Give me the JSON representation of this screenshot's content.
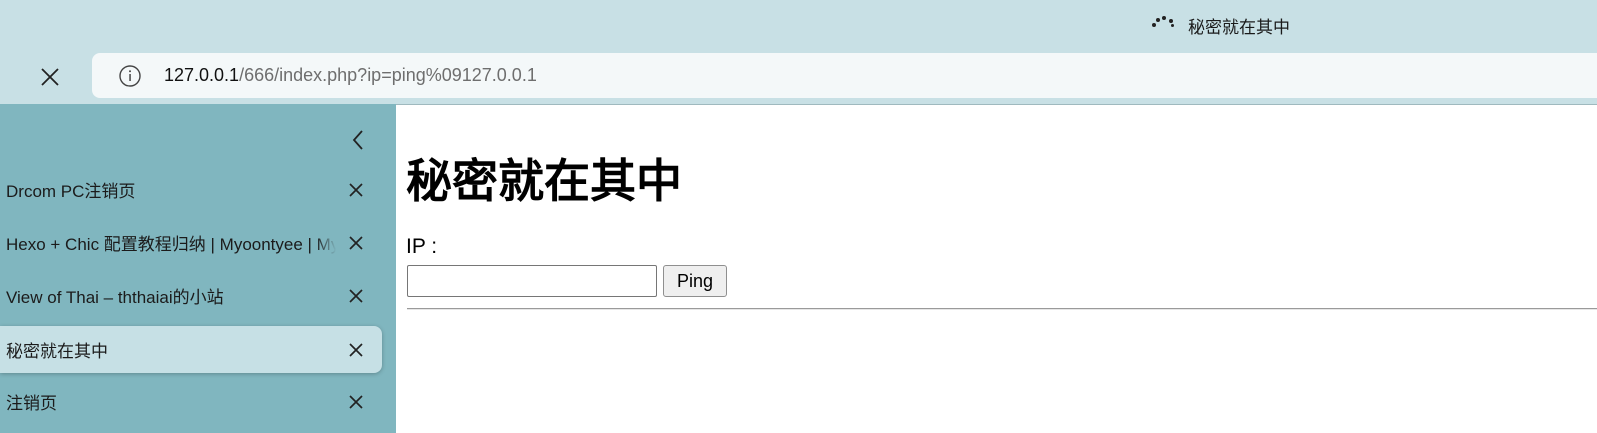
{
  "window": {
    "title": "秘密就在其中",
    "loading": true
  },
  "toolbar": {
    "url_host": "127.0.0.1",
    "url_path": "/666/index.php?ip=ping%09127.0.0.1"
  },
  "icons": {
    "loading": "loading-spinner-icon",
    "stop": "close-icon",
    "info": "info-icon",
    "collapse": "chevron-left-icon",
    "tab_close": "close-icon"
  },
  "sidebar": {
    "tabs": [
      {
        "label": "Drcom PC注销页",
        "active": false
      },
      {
        "label": "Hexo + Chic 配置教程归纳 | Myoontyee | Myoontyee",
        "active": false
      },
      {
        "label": "View of Thai – ththaiai的小站",
        "active": false
      },
      {
        "label": "秘密就在其中",
        "active": true
      },
      {
        "label": "注销页",
        "active": false
      }
    ]
  },
  "page": {
    "heading": "秘密就在其中",
    "ip_label": "IP :",
    "ip_value": "",
    "ping_button": "Ping"
  },
  "colors": {
    "titlebar": "#c8e0e5",
    "sidebar": "#80b6bf",
    "active_tab": "#c6e0e5",
    "address_bar": "#f4f8f9",
    "content": "#ffffff"
  }
}
